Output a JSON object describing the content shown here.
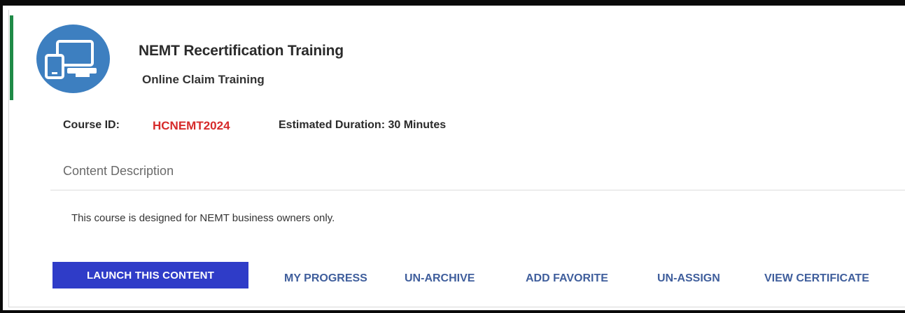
{
  "course": {
    "title": "NEMT Recertification Training",
    "subtitle": "Online Claim Training",
    "icon": "devices-icon",
    "course_id_label": "Course ID:",
    "course_id_value": "HCNEMT2024",
    "duration_label": "Estimated Duration: 30 Minutes"
  },
  "content": {
    "heading": "Content Description",
    "description": "This course is designed for NEMT business owners only."
  },
  "actions": {
    "launch": "LAUNCH THIS CONTENT",
    "my_progress": "MY PROGRESS",
    "un_archive": "UN-ARCHIVE",
    "add_favorite": "ADD FAVORITE",
    "un_assign": "UN-ASSIGN",
    "view_certificate": "VIEW CERTIFICATE"
  },
  "colors": {
    "accent_bar": "#1f8a47",
    "icon_circle": "#3d7fc0",
    "course_id": "#d62a2a",
    "launch_button": "#2f3cc8",
    "action_links": "#3f5e9c"
  }
}
